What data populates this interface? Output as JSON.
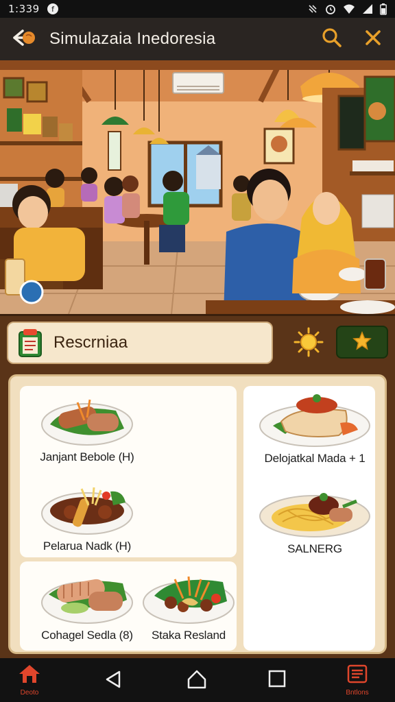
{
  "status_bar": {
    "time": "1:339"
  },
  "header": {
    "title": "Simulazaia Inedoresia"
  },
  "section": {
    "title": "Rescrniaa"
  },
  "dishes": [
    {
      "name": "Janjant Bebole (H)"
    },
    {
      "name": "Delojatkal Mada + 1"
    },
    {
      "name": "Pelarua Nadk (H)"
    },
    {
      "name": "SALNERG"
    },
    {
      "name": "Cohagel Sedla (8)"
    },
    {
      "name": "Staka Resland"
    }
  ],
  "nav": {
    "home_label": "Deoto",
    "right_label": "Bntlons"
  },
  "colors": {
    "accent": "#e8a02a",
    "header_bg": "#2a2522",
    "section_bg": "#5a3418",
    "nav_accent": "#e0462c"
  },
  "icons": [
    "back-arrow-icon",
    "search-icon",
    "close-icon",
    "clipboard-icon",
    "sun-icon",
    "star-icon",
    "home-icon",
    "back-triangle-icon",
    "circle-home-icon",
    "square-recents-icon",
    "menu-book-icon"
  ]
}
